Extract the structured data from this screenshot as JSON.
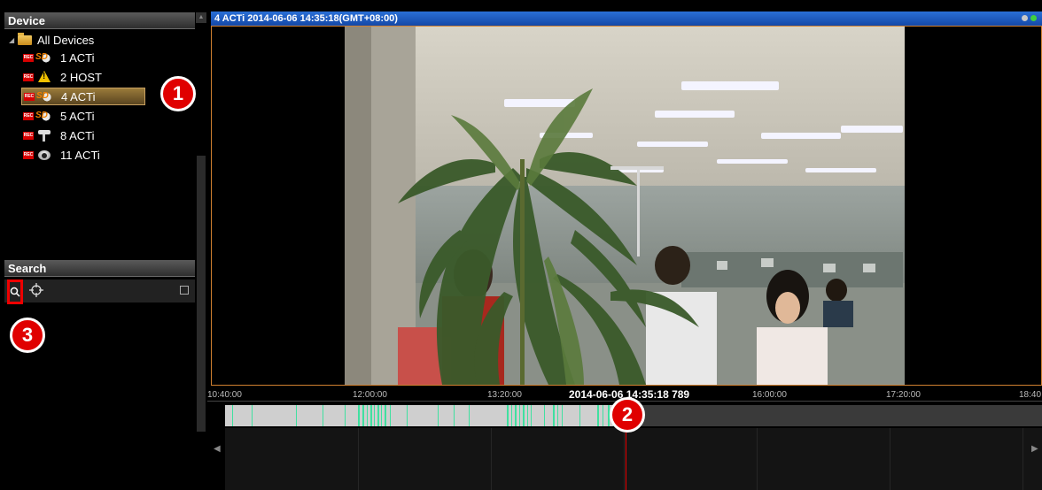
{
  "device_panel": {
    "title": "Device",
    "root_label": "All Devices",
    "devices": [
      {
        "label": "1 ACTi",
        "icon": "sd-card-icon",
        "rec": "REC"
      },
      {
        "label": "2 HOST",
        "icon": "warning-icon",
        "rec": "REC"
      },
      {
        "label": "4 ACTi",
        "icon": "sd-card-icon",
        "rec": "REC",
        "selected": true
      },
      {
        "label": "5 ACTi",
        "icon": "sd-card-icon",
        "rec": "REC"
      },
      {
        "label": "8 ACTi",
        "icon": "bullet-camera-icon",
        "rec": "REC"
      },
      {
        "label": "11 ACTi",
        "icon": "dome-camera-icon",
        "rec": "REC"
      }
    ]
  },
  "search_panel": {
    "title": "Search"
  },
  "video": {
    "title": "4 ACTi  2014-06-06 14:35:18(GMT+08:00)",
    "led_colors": [
      "#c8c8c8",
      "#40d040"
    ]
  },
  "timeline": {
    "labels": [
      "10:40:00",
      "12:00:00",
      "13:20:00",
      "16:00:00",
      "17:20:00",
      "18:40"
    ],
    "current": "2014-06-06 14:35:18 789",
    "cursor_color": "#e00000",
    "recording_color": "#40e0a0"
  },
  "annotations": [
    "1",
    "2",
    "3"
  ],
  "colors": {
    "selection": "#8a6a30",
    "title_bar": "#1e5cc8",
    "highlight": "#e00000"
  }
}
